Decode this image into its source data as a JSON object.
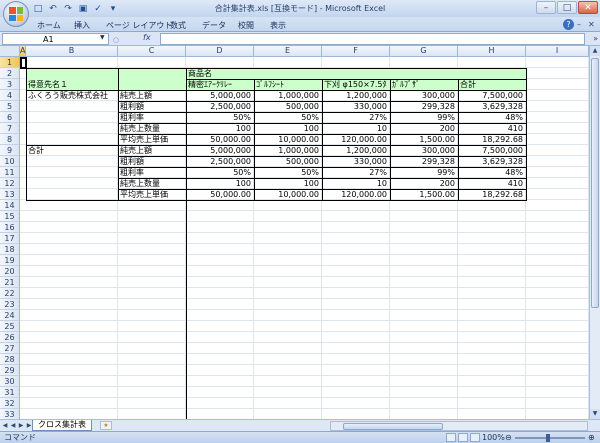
{
  "window": {
    "title": "合計集計表.xls [互換モード] - Microsoft Excel"
  },
  "quick_access": [
    "save-icon",
    "undo-icon",
    "redo-icon",
    "print-preview-icon",
    "spell-icon",
    "customize-icon"
  ],
  "ribbon_tabs": [
    "ホーム",
    "挿入",
    "ページ レイアウト",
    "数式",
    "データ",
    "校閲",
    "表示"
  ],
  "formula_bar": {
    "name_box": "A1",
    "fx_label": "fx",
    "formula": ""
  },
  "columns": [
    "A",
    "B",
    "C",
    "D",
    "E",
    "F",
    "G",
    "H",
    "I"
  ],
  "rows": [
    "1",
    "2",
    "3",
    "4",
    "5",
    "6",
    "7",
    "8",
    "9",
    "10",
    "11",
    "12",
    "13",
    "14",
    "15",
    "16",
    "17",
    "18",
    "19",
    "20",
    "21",
    "22",
    "23",
    "24",
    "25",
    "26",
    "27",
    "28",
    "29",
    "30",
    "31",
    "32",
    "33"
  ],
  "sheet": {
    "header_group": "商品名",
    "header_customer": "得意先名１",
    "products": [
      "精密ｴｱｰｸﾘﾚｰ",
      "ｺﾞﾙﾌｼｰﾄ",
      "下刈 φ150×7.5ﾀ",
      "ｶﾞﾙﾌﾞｻﾞ",
      "合計"
    ],
    "groups": [
      {
        "name": "ふくろう販売株式会社",
        "rows": [
          {
            "label": "純売上額",
            "values": [
              "5,000,000",
              "1,000,000",
              "1,200,000",
              "300,000",
              "7,500,000"
            ]
          },
          {
            "label": "粗利額",
            "values": [
              "2,500,000",
              "500,000",
              "330,000",
              "299,328",
              "3,629,328"
            ]
          },
          {
            "label": "粗利率",
            "values": [
              "50%",
              "50%",
              "27%",
              "99%",
              "48%"
            ]
          },
          {
            "label": "純売上数量",
            "values": [
              "100",
              "100",
              "10",
              "200",
              "410"
            ]
          },
          {
            "label": "平均売上単価",
            "values": [
              "50,000.00",
              "10,000.00",
              "120,000.00",
              "1,500.00",
              "18,292.68"
            ]
          }
        ]
      },
      {
        "name": "合計",
        "rows": [
          {
            "label": "純売上額",
            "values": [
              "5,000,000",
              "1,000,000",
              "1,200,000",
              "300,000",
              "7,500,000"
            ]
          },
          {
            "label": "粗利額",
            "values": [
              "2,500,000",
              "500,000",
              "330,000",
              "299,328",
              "3,629,328"
            ]
          },
          {
            "label": "粗利率",
            "values": [
              "50%",
              "50%",
              "27%",
              "99%",
              "48%"
            ]
          },
          {
            "label": "純売上数量",
            "values": [
              "100",
              "100",
              "10",
              "200",
              "410"
            ]
          },
          {
            "label": "平均売上単価",
            "values": [
              "50,000.00",
              "10,000.00",
              "120,000.00",
              "1,500.00",
              "18,292.68"
            ]
          }
        ]
      }
    ]
  },
  "sheet_tabs": {
    "active": "クロス集計表"
  },
  "status": {
    "mode": "コマンド",
    "zoom": "100%"
  },
  "colors": {
    "header_fill": "#ccffcc",
    "ribbon": "#c4d6ee",
    "selected_header": "#f3c35a"
  }
}
